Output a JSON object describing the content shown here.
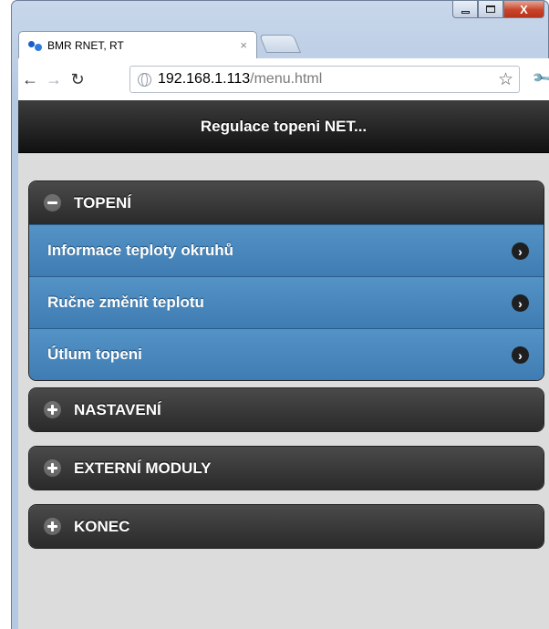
{
  "browser": {
    "tab_title": "BMR RNET, RT",
    "tab_close": "×",
    "url_host": "192.168.1.113",
    "url_path": "/menu.html",
    "icons": [
      "back-icon",
      "forward-icon",
      "reload-icon",
      "globe-icon",
      "star-icon",
      "wrench-icon"
    ]
  },
  "window_controls": {
    "close": "X"
  },
  "header": {
    "title": "Regulace topeni NET..."
  },
  "sections": [
    {
      "label": "TOPENÍ",
      "expanded": true,
      "items": [
        "Informace teploty okruhů",
        "Ručne změnit teplotu",
        "Útlum topeni"
      ]
    },
    {
      "label": "NASTAVENÍ",
      "expanded": false
    },
    {
      "label": "EXTERNÍ MODULY",
      "expanded": false
    },
    {
      "label": "KONEC",
      "expanded": false
    }
  ],
  "colors": {
    "header_bg": "#111111",
    "section_bg": "#2a2a2a",
    "item_bg": "#4a88bd",
    "page_bg": "#dcdcdc"
  }
}
